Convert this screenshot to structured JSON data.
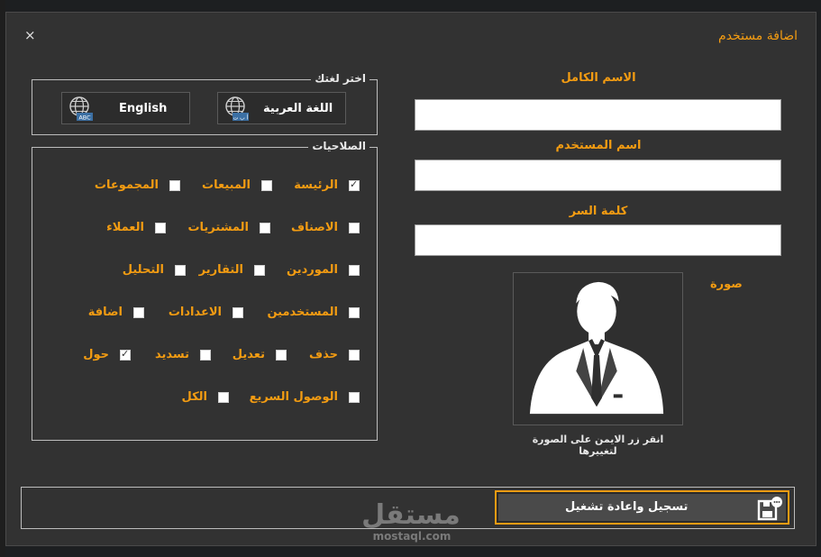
{
  "window": {
    "title": "اضافة مستخدم",
    "close_glyph": "×"
  },
  "language": {
    "legend": "اختر لغتك",
    "english_label": "English",
    "arabic_label": "اللغة العربية",
    "english_badge": "ABC",
    "arabic_badge": "أ ب ت"
  },
  "permissions": {
    "legend": "الصلاحيات",
    "items": [
      {
        "label": "الرئيسة",
        "checked": true
      },
      {
        "label": "المبيعات",
        "checked": false
      },
      {
        "label": "المجموعات",
        "checked": false
      },
      {
        "label": "الاصناف",
        "checked": false
      },
      {
        "label": "المشتريات",
        "checked": false
      },
      {
        "label": "العملاء",
        "checked": false
      },
      {
        "label": "الموردين",
        "checked": false
      },
      {
        "label": "التقارير",
        "checked": false
      },
      {
        "label": "التحليل",
        "checked": false
      },
      {
        "label": "المستخدمين",
        "checked": false
      },
      {
        "label": "الاعدادات",
        "checked": false
      },
      {
        "label": "اضافة",
        "checked": false
      },
      {
        "label": "حذف",
        "checked": false
      },
      {
        "label": "تعديل",
        "checked": false
      },
      {
        "label": "تسديد",
        "checked": false
      },
      {
        "label": "حول",
        "checked": true
      },
      {
        "label": "الوصول السريع",
        "checked": false
      },
      {
        "label": "الكل",
        "checked": false
      }
    ]
  },
  "form": {
    "fullname_label": "الاسم الكامل",
    "fullname_value": "",
    "username_label": "اسم المستخدم",
    "username_value": "",
    "password_label": "كلمة السر",
    "password_value": ""
  },
  "photo": {
    "label": "صورة",
    "hint": "انقر زر الايمن على الصورة لتغييرها",
    "icon": "user-silhouette-icon"
  },
  "actions": {
    "submit_label": "تسجيل واعادة تشغيل"
  },
  "watermark": {
    "arabic": "مستقل",
    "latin": "mostaql.com"
  },
  "colors": {
    "accent": "#f39c12",
    "window_bg": "#323232",
    "text_light": "#e8e8e8"
  }
}
